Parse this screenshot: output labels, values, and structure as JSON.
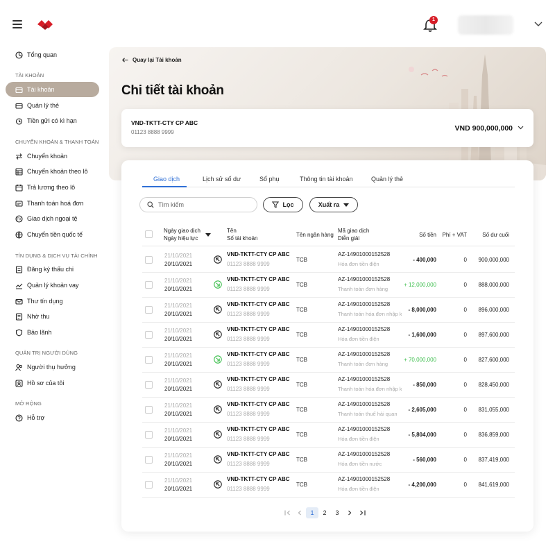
{
  "header": {
    "notification_count": "1"
  },
  "sidebar": {
    "overview": "Tổng quan",
    "sections": [
      "TÀI KHOẢN",
      "CHUYỂN KHOẢN & THANH TOÁN",
      "TÍN DỤNG & DỊCH VỤ TÀI CHÍNH",
      "QUẢN TRỊ NGƯỜI DÙNG",
      "MỞ RỘNG"
    ],
    "items": [
      "Tài khoản",
      "Quản lý thẻ",
      "Tiền gửi có kì hạn",
      "Chuyển khoản",
      "Chuyển khoản theo lô",
      "Trả lương theo lô",
      "Thanh toán hoá đơn",
      "Giao dịch ngoại tệ",
      "Chuyển tiền quốc tế",
      "Đăng ký thấu chi",
      "Quản lý khoản vay",
      "Thư tín dụng",
      "Nhờ thu",
      "Bảo lãnh",
      "Người thụ hưởng",
      "Hồ sơ của tôi",
      "Hỗ trợ"
    ],
    "active_item": "Tài khoản"
  },
  "page": {
    "back_label": "Quay lại Tài khoản",
    "title": "Chi tiết tài khoản"
  },
  "account": {
    "name": "VND-TKTT-CTY CP ABC",
    "number": "01123 8888 9999",
    "balance": "VND 900,000,000"
  },
  "tabs": [
    "Giao dịch",
    "Lịch sử số dư",
    "Sổ phụ",
    "Thông tin tài khoản",
    "Quản lý thẻ"
  ],
  "toolbar": {
    "search_placeholder": "Tìm kiếm",
    "filter_label": "Lọc",
    "export_label": "Xuất ra"
  },
  "table": {
    "headers": {
      "date_line1": "Ngày giao dịch",
      "date_line2": "Ngày hiệu lực",
      "name_line1": "Tên",
      "name_line2": "Số tài khoản",
      "bank": "Tên ngân hàng",
      "code_line1": "Mã giao dịch",
      "code_line2": "Diễn giải",
      "amount": "Số tiền",
      "fee": "Phí + VAT",
      "balance": "Số dư cuối"
    },
    "rows": [
      {
        "date": "21/10/2021",
        "effective": "20/10/2021",
        "direction": "out",
        "name": "VND-TKTT-CTY CP ABC",
        "account": "01123 8888 9999",
        "bank": "TCB",
        "code": "AZ-14901000152528",
        "desc": "Hóa đơn tiền điện",
        "amount": "- 400,000",
        "fee": "0",
        "balance": "900,000,000"
      },
      {
        "date": "21/10/2021",
        "effective": "20/10/2021",
        "direction": "in",
        "name": "VND-TKTT-CTY CP ABC",
        "account": "01123 8888 9999",
        "bank": "TCB",
        "code": "AZ-14901000152528",
        "desc": "Thanh toán đơn hàng",
        "amount": "+ 12,000,000",
        "fee": "0",
        "balance": "888,000,000"
      },
      {
        "date": "21/10/2021",
        "effective": "20/10/2021",
        "direction": "out",
        "name": "VND-TKTT-CTY CP ABC",
        "account": "01123 8888 9999",
        "bank": "TCB",
        "code": "AZ-14901000152528",
        "desc": "Thanh toán hóa đơn nhập k",
        "amount": "- 8,000,000",
        "fee": "0",
        "balance": "896,000,000"
      },
      {
        "date": "21/10/2021",
        "effective": "20/10/2021",
        "direction": "out",
        "name": "VND-TKTT-CTY CP ABC",
        "account": "01123 8888 9999",
        "bank": "TCB",
        "code": "AZ-14901000152528",
        "desc": "Hóa đơn tiền điện",
        "amount": "- 1,600,000",
        "fee": "0",
        "balance": "897,600,000"
      },
      {
        "date": "21/10/2021",
        "effective": "20/10/2021",
        "direction": "in",
        "name": "VND-TKTT-CTY CP ABC",
        "account": "01123 8888 9999",
        "bank": "TCB",
        "code": "AZ-14901000152528",
        "desc": "Thanh toán đơn hàng",
        "amount": "+ 70,000,000",
        "fee": "0",
        "balance": "827,600,000"
      },
      {
        "date": "21/10/2021",
        "effective": "20/10/2021",
        "direction": "out",
        "name": "VND-TKTT-CTY CP ABC",
        "account": "01123 8888 9999",
        "bank": "TCB",
        "code": "AZ-14901000152528",
        "desc": "Thanh toán hóa đơn nhập k",
        "amount": "- 850,000",
        "fee": "0",
        "balance": "828,450,000"
      },
      {
        "date": "21/10/2021",
        "effective": "20/10/2021",
        "direction": "out",
        "name": "VND-TKTT-CTY CP ABC",
        "account": "01123 8888 9999",
        "bank": "TCB",
        "code": "AZ-14901000152528",
        "desc": "Thanh toán thuế hải quan",
        "amount": "- 2,605,000",
        "fee": "0",
        "balance": "831,055,000"
      },
      {
        "date": "21/10/2021",
        "effective": "20/10/2021",
        "direction": "out",
        "name": "VND-TKTT-CTY CP ABC",
        "account": "01123 8888 9999",
        "bank": "TCB",
        "code": "AZ-14901000152528",
        "desc": "Hóa đơn tiền điện",
        "amount": "- 5,804,000",
        "fee": "0",
        "balance": "836,859,000"
      },
      {
        "date": "21/10/2021",
        "effective": "20/10/2021",
        "direction": "out",
        "name": "VND-TKTT-CTY CP ABC",
        "account": "01123 8888 9999",
        "bank": "TCB",
        "code": "AZ-14901000152528",
        "desc": "Hóa đơn tiền nước",
        "amount": "- 560,000",
        "fee": "0",
        "balance": "837,419,000"
      },
      {
        "date": "21/10/2021",
        "effective": "20/10/2021",
        "direction": "out",
        "name": "VND-TKTT-CTY CP ABC",
        "account": "01123 8888 9999",
        "bank": "TCB",
        "code": "AZ-14901000152528",
        "desc": "Hóa đơn tiền điện",
        "amount": "- 4,200,000",
        "fee": "0",
        "balance": "841,619,000"
      }
    ]
  },
  "pagination": {
    "pages": [
      "1",
      "2",
      "3"
    ],
    "current": "1"
  },
  "colors": {
    "brand": "#d71e28",
    "accent": "#2f6fd6",
    "active_nav": "#b8ab9e",
    "credit": "#3fbf4f"
  },
  "icons": {
    "sidebar": [
      "grid-icon",
      "wallet-icon",
      "card-icon",
      "piggy-icon",
      "transfer-icon",
      "batch-icon",
      "payroll-icon",
      "bill-icon",
      "fx-icon",
      "globe-icon",
      "overdraft-icon",
      "loan-icon",
      "letter-icon",
      "collect-icon",
      "shield-icon",
      "beneficiary-icon",
      "profile-icon",
      "help-icon"
    ]
  }
}
